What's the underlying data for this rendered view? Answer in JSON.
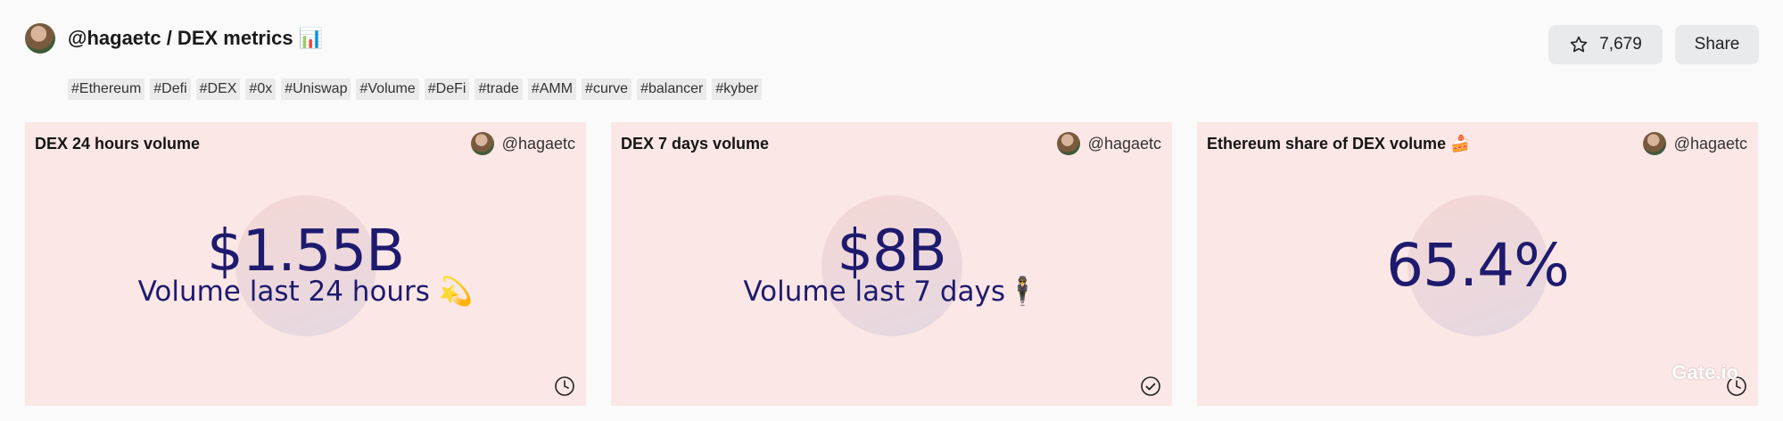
{
  "header": {
    "title": "@hagaetc / DEX metrics 📊"
  },
  "tags": [
    "#Ethereum",
    "#Defi",
    "#DEX",
    "#0x",
    "#Uniswap",
    "#Volume",
    "#DeFi",
    "#trade",
    "#AMM",
    "#curve",
    "#balancer",
    "#kyber"
  ],
  "actions": {
    "star_count": "7,679",
    "share_label": "Share"
  },
  "cards": [
    {
      "title": "DEX 24 hours volume",
      "author": "@hagaetc",
      "value": "$1.55B",
      "subtitle": "Volume last 24 hours 💫",
      "icon": "clock-icon"
    },
    {
      "title": "DEX 7 days volume",
      "author": "@hagaetc",
      "value": "$8B",
      "subtitle": "Volume last 7 days🕴",
      "icon": "check-circle-icon"
    },
    {
      "title": "Ethereum share of DEX volume 🍰",
      "author": "@hagaetc",
      "value": "65.4%",
      "subtitle": "",
      "icon": "clock-icon"
    }
  ],
  "watermark": "Gate.io"
}
